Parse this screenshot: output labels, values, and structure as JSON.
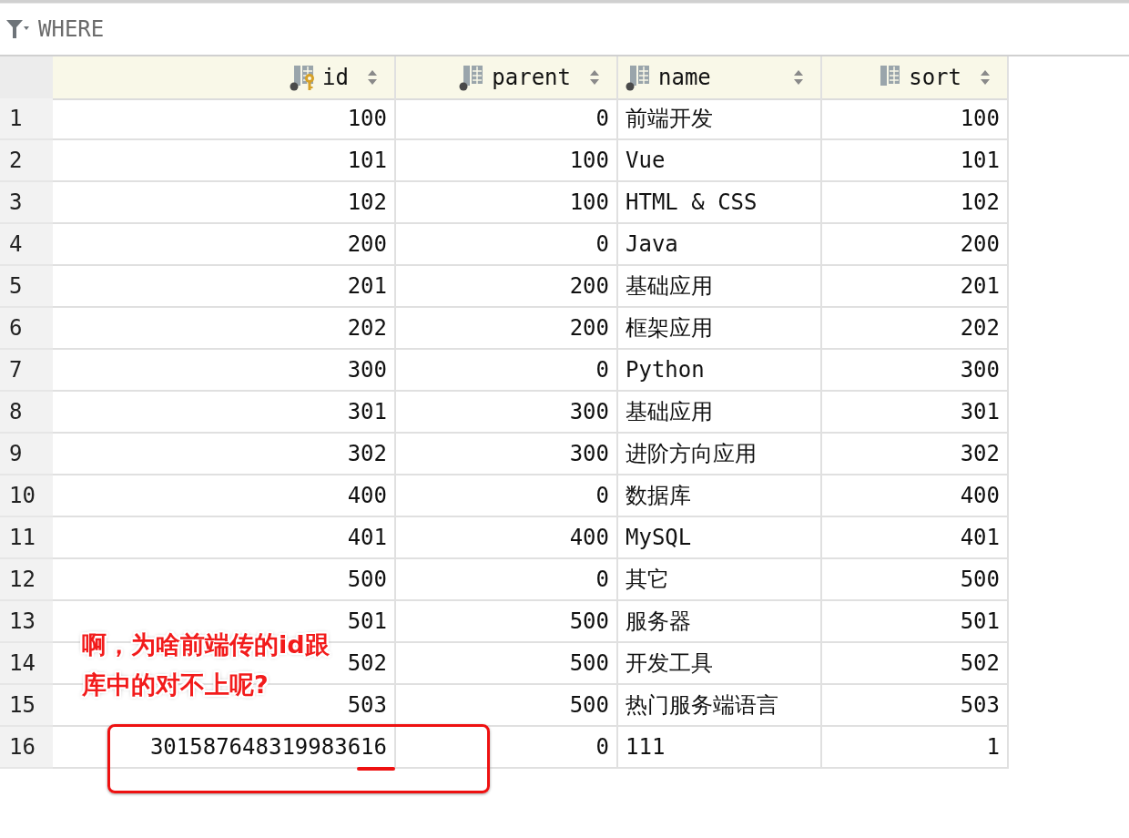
{
  "filter_bar": {
    "label": "WHERE"
  },
  "table": {
    "columns": [
      {
        "label": "id",
        "kind": "primary_key",
        "not_null": true,
        "numeric": true
      },
      {
        "label": "parent",
        "kind": "column",
        "not_null": true,
        "numeric": true
      },
      {
        "label": "name",
        "kind": "column",
        "not_null": true,
        "numeric": false
      },
      {
        "label": "sort",
        "kind": "column",
        "not_null": false,
        "numeric": true
      }
    ],
    "rows": [
      {
        "number": "1",
        "cells": [
          "100",
          "0",
          "前端开发",
          "100"
        ]
      },
      {
        "number": "2",
        "cells": [
          "101",
          "100",
          "Vue",
          "101"
        ]
      },
      {
        "number": "3",
        "cells": [
          "102",
          "100",
          "HTML & CSS",
          "102"
        ]
      },
      {
        "number": "4",
        "cells": [
          "200",
          "0",
          "Java",
          "200"
        ]
      },
      {
        "number": "5",
        "cells": [
          "201",
          "200",
          "基础应用",
          "201"
        ]
      },
      {
        "number": "6",
        "cells": [
          "202",
          "200",
          "框架应用",
          "202"
        ]
      },
      {
        "number": "7",
        "cells": [
          "300",
          "0",
          "Python",
          "300"
        ]
      },
      {
        "number": "8",
        "cells": [
          "301",
          "300",
          "基础应用",
          "301"
        ]
      },
      {
        "number": "9",
        "cells": [
          "302",
          "300",
          "进阶方向应用",
          "302"
        ]
      },
      {
        "number": "10",
        "cells": [
          "400",
          "0",
          "数据库",
          "400"
        ]
      },
      {
        "number": "11",
        "cells": [
          "401",
          "400",
          "MySQL",
          "401"
        ]
      },
      {
        "number": "12",
        "cells": [
          "500",
          "0",
          "其它",
          "500"
        ]
      },
      {
        "number": "13",
        "cells": [
          "501",
          "500",
          "服务器",
          "501"
        ]
      },
      {
        "number": "14",
        "cells": [
          "502",
          "500",
          "开发工具",
          "502"
        ]
      },
      {
        "number": "15",
        "cells": [
          "503",
          "500",
          "热门服务端语言",
          "503"
        ]
      },
      {
        "number": "16",
        "cells": [
          "301587648319983616",
          "0",
          "111",
          "1"
        ]
      }
    ]
  },
  "annotation": {
    "lines": [
      "啊，为啥前端传的id跟",
      "库中的对不上呢?"
    ]
  }
}
